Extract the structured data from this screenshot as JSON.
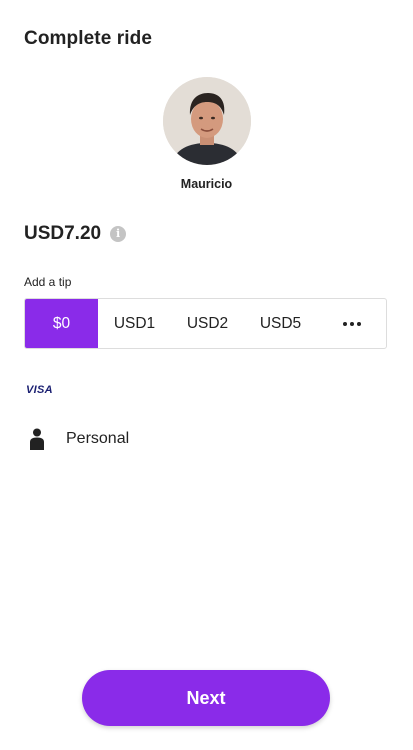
{
  "header": {
    "title": "Complete ride"
  },
  "driver": {
    "name": "Mauricio"
  },
  "fare": {
    "amount": "USD7.20",
    "info_icon": "info-icon"
  },
  "tip": {
    "label": "Add a tip",
    "options": [
      "$0",
      "USD1",
      "USD2",
      "USD5"
    ],
    "selected": "$0",
    "more_icon": "more-horizontal-icon"
  },
  "payment": {
    "card_brand": "VISA",
    "profile_icon": "person-icon",
    "profile_label": "Personal"
  },
  "actions": {
    "next_label": "Next"
  },
  "colors": {
    "accent": "#8a2be9",
    "card_brand": "#1a1f71",
    "info_icon": "#c4c4c4"
  }
}
